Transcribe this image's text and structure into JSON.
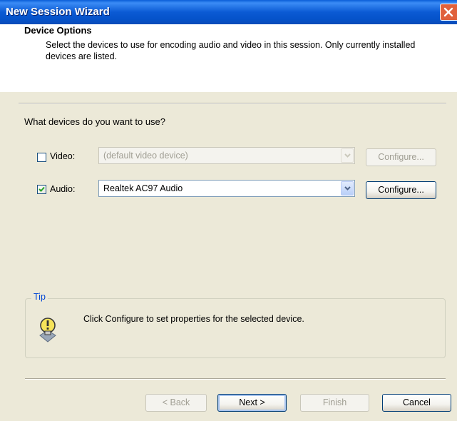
{
  "window": {
    "title": "New Session Wizard"
  },
  "header": {
    "title": "Device Options",
    "description": "Select the devices to use for encoding audio and video in this session. Only currently installed devices are listed."
  },
  "question": "What devices do you want to use?",
  "devices": {
    "video": {
      "label": "Video:",
      "checked": false,
      "selected": "(default video device)",
      "configure_label": "Configure...",
      "enabled": false
    },
    "audio": {
      "label": "Audio:",
      "checked": true,
      "selected": "Realtek AC97 Audio",
      "configure_label": "Configure...",
      "enabled": true
    }
  },
  "tip": {
    "legend": "Tip",
    "text": "Click Configure to set properties for the selected device.",
    "icon": "lightbulb-icon"
  },
  "footer": {
    "back_label": "< Back",
    "next_label": "Next >",
    "finish_label": "Finish",
    "cancel_label": "Cancel"
  },
  "colors": {
    "titlebar": "#0A5FD8",
    "tip_legend": "#0046D5",
    "close": "#E0613C"
  }
}
